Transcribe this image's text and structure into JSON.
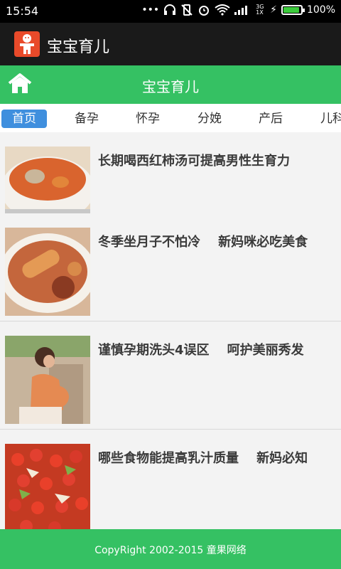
{
  "status_bar": {
    "time": "15:54",
    "battery_percent": "100%",
    "network_label": "3G 1X",
    "battery_level": 1.0
  },
  "app_bar": {
    "title": "宝宝育儿"
  },
  "nav_bar": {
    "title": "宝宝育儿"
  },
  "tabs": [
    {
      "label": "首页",
      "active": true
    },
    {
      "label": "备孕"
    },
    {
      "label": "怀孕"
    },
    {
      "label": "分娩"
    },
    {
      "label": "产后"
    },
    {
      "label": "儿科"
    }
  ],
  "articles": [
    {
      "title": "长期喝西红柿汤可提高男性生育力"
    },
    {
      "title": "冬季坐月子不怕冷    新妈咪必吃美食"
    },
    {
      "title": "谨慎孕期洗头4误区    呵护美丽秀发"
    },
    {
      "title": "哪些食物能提高乳汁质量    新妈必知"
    }
  ],
  "footer": {
    "text": "CopyRight 2002-2015 童果网络"
  },
  "colors": {
    "primary_green": "#35c163",
    "tab_active": "#3f8fde",
    "app_bar": "#1a1a1a"
  },
  "icons": {
    "home": "home-icon",
    "app": "gingerbread-app-icon"
  }
}
